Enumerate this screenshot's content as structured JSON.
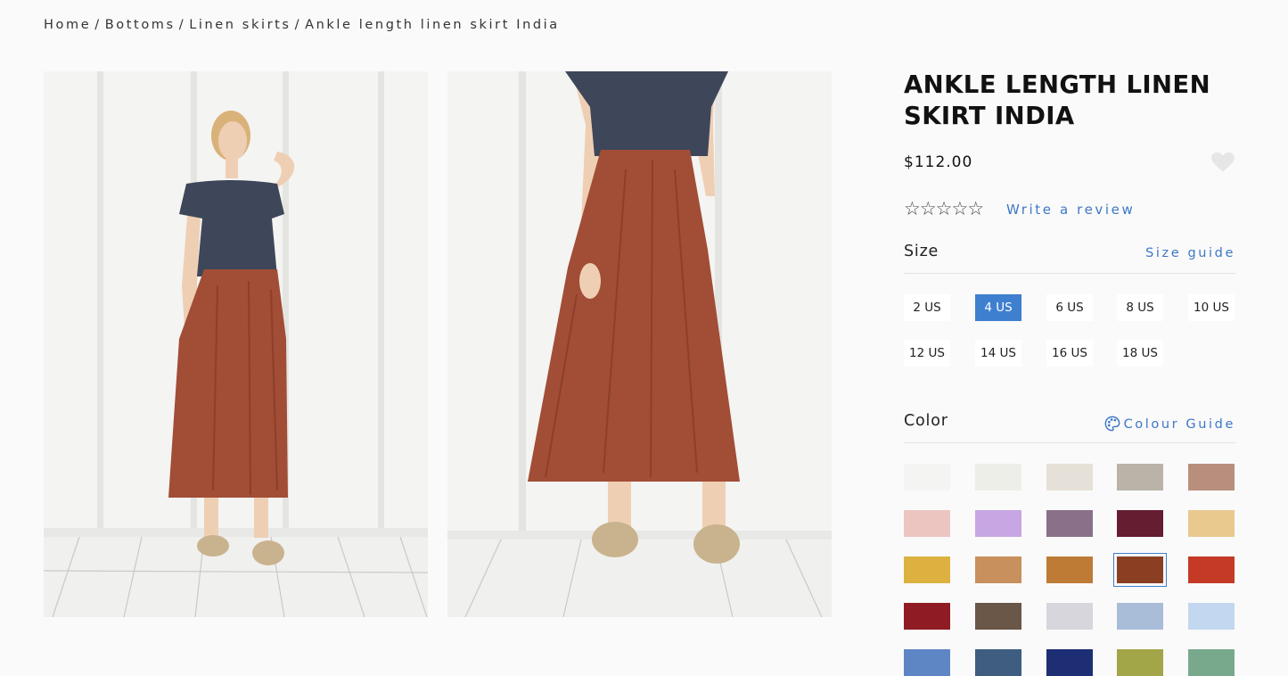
{
  "breadcrumb": {
    "home": "Home",
    "bottoms": "Bottoms",
    "linen_skirts": "Linen skirts",
    "current": "Ankle length linen skirt India",
    "separator": "/"
  },
  "product": {
    "title": "ANKLE LENGTH LINEN SKIRT INDIA",
    "price": "$112.00",
    "stars": "☆☆☆☆☆",
    "write_review": "Write a review",
    "wishlist_icon": "heart-icon"
  },
  "size": {
    "label": "Size",
    "guide_link": "Size guide",
    "options": [
      "2 US",
      "4 US",
      "6 US",
      "8 US",
      "10 US",
      "12 US",
      "14 US",
      "16 US",
      "18 US"
    ],
    "selected": "4 US"
  },
  "color": {
    "label": "Color",
    "guide_link": "Colour Guide",
    "guide_icon": "palette-icon",
    "swatches": [
      "#f4f4f2",
      "#eeeee8",
      "#e6e1d8",
      "#b9b3a8",
      "#b88f7c",
      "#ecc5c0",
      "#c7a6e3",
      "#8a7089",
      "#651d31",
      "#e9c98e",
      "#dcb13f",
      "#c7905c",
      "#bd7b36",
      "#8a3f22",
      "#c43a26",
      "#8f1c25",
      "#6a5748",
      "#d6d6dc",
      "#a9bdd8",
      "#c3d8f0",
      "#5f86c4",
      "#3f5d80",
      "#1d2e74",
      "#a3a549",
      "#78a98d"
    ],
    "selected_index": 13
  },
  "accent_color": "#3f7fd0"
}
